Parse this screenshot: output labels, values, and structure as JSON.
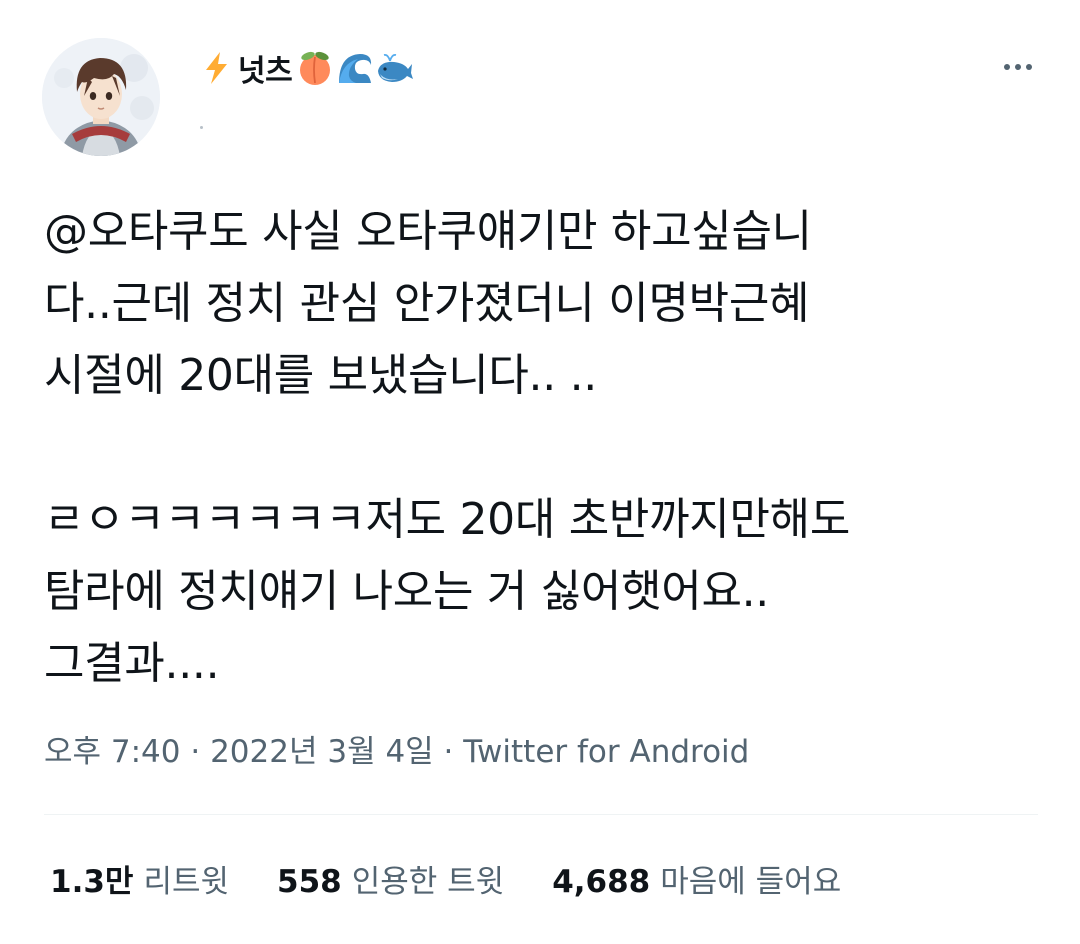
{
  "author": {
    "display_name": "넛츠",
    "name_emojis": [
      "lightning-emoji",
      "peach-emoji",
      "wave-emoji",
      "whale-emoji"
    ],
    "avatar": "anime-boy-avatar"
  },
  "tweet": {
    "paragraphs": [
      "@오타쿠도 사실 오타쿠얘기만 하고싶습니\n다..근데 정치 관심 안가졌더니 이명박근혜\n시절에 20대를 보냈습니다.. ..",
      "ㄹㅇㅋㅋㅋㅋㅋㅋ저도 20대 초반까지만해도\n탐라에 정치얘기 나오는 거 싫어햇어요..\n그결과...."
    ],
    "time": "오후 7:40",
    "date": "2022년 3월 4일",
    "source": "Twitter for Android",
    "separator": " · "
  },
  "stats": {
    "retweets": {
      "count": "1.3만",
      "label": "리트윗"
    },
    "quotes": {
      "count": "558",
      "label": "인용한 트윗"
    },
    "likes": {
      "count": "4,688",
      "label": "마음에 들어요"
    }
  },
  "colors": {
    "text_primary": "#0f1419",
    "text_secondary": "#536471",
    "divider": "#eff3f4"
  }
}
